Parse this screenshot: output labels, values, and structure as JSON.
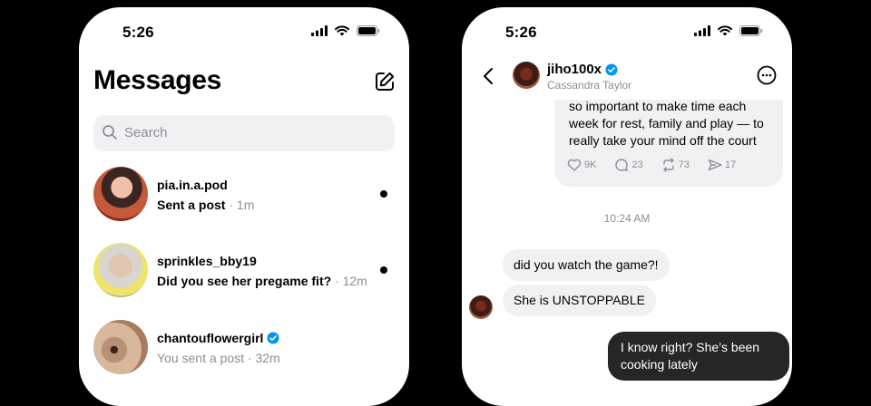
{
  "status_bar": {
    "time": "5:26"
  },
  "inbox": {
    "title": "Messages",
    "search": {
      "placeholder": "Search"
    },
    "conversations": [
      {
        "username": "pia.in.a.pod",
        "preview": "Sent a post",
        "time": "· 1m",
        "unread": true,
        "verified": false
      },
      {
        "username": "sprinkles_bby19",
        "preview": "Did you see her pregame fit?",
        "time": "· 12m",
        "unread": true,
        "verified": false
      },
      {
        "username": "chantouflowergirl",
        "preview": "You sent a post",
        "time": "· 32m",
        "unread": false,
        "verified": true
      }
    ]
  },
  "chat": {
    "header": {
      "username": "jiho100x",
      "name": "Cassandra Taylor",
      "verified": true
    },
    "shared_post": {
      "text": "so important to make time each week for rest, family and play — to really take your mind off the court",
      "likes": "9K",
      "replies": "23",
      "reposts": "73",
      "shares": "17"
    },
    "timestamp": "10:24 AM",
    "messages": [
      {
        "from": "them",
        "text": "did you watch the game?!"
      },
      {
        "from": "them",
        "text": "She is UNSTOPPABLE"
      },
      {
        "from": "me",
        "text": "I know right? She’s been cooking lately"
      }
    ]
  },
  "colors": {
    "verified": "#0095f6",
    "bubble_in": "#f1f1f3",
    "bubble_out": "#262626",
    "meta_gray": "#8e8e93"
  }
}
